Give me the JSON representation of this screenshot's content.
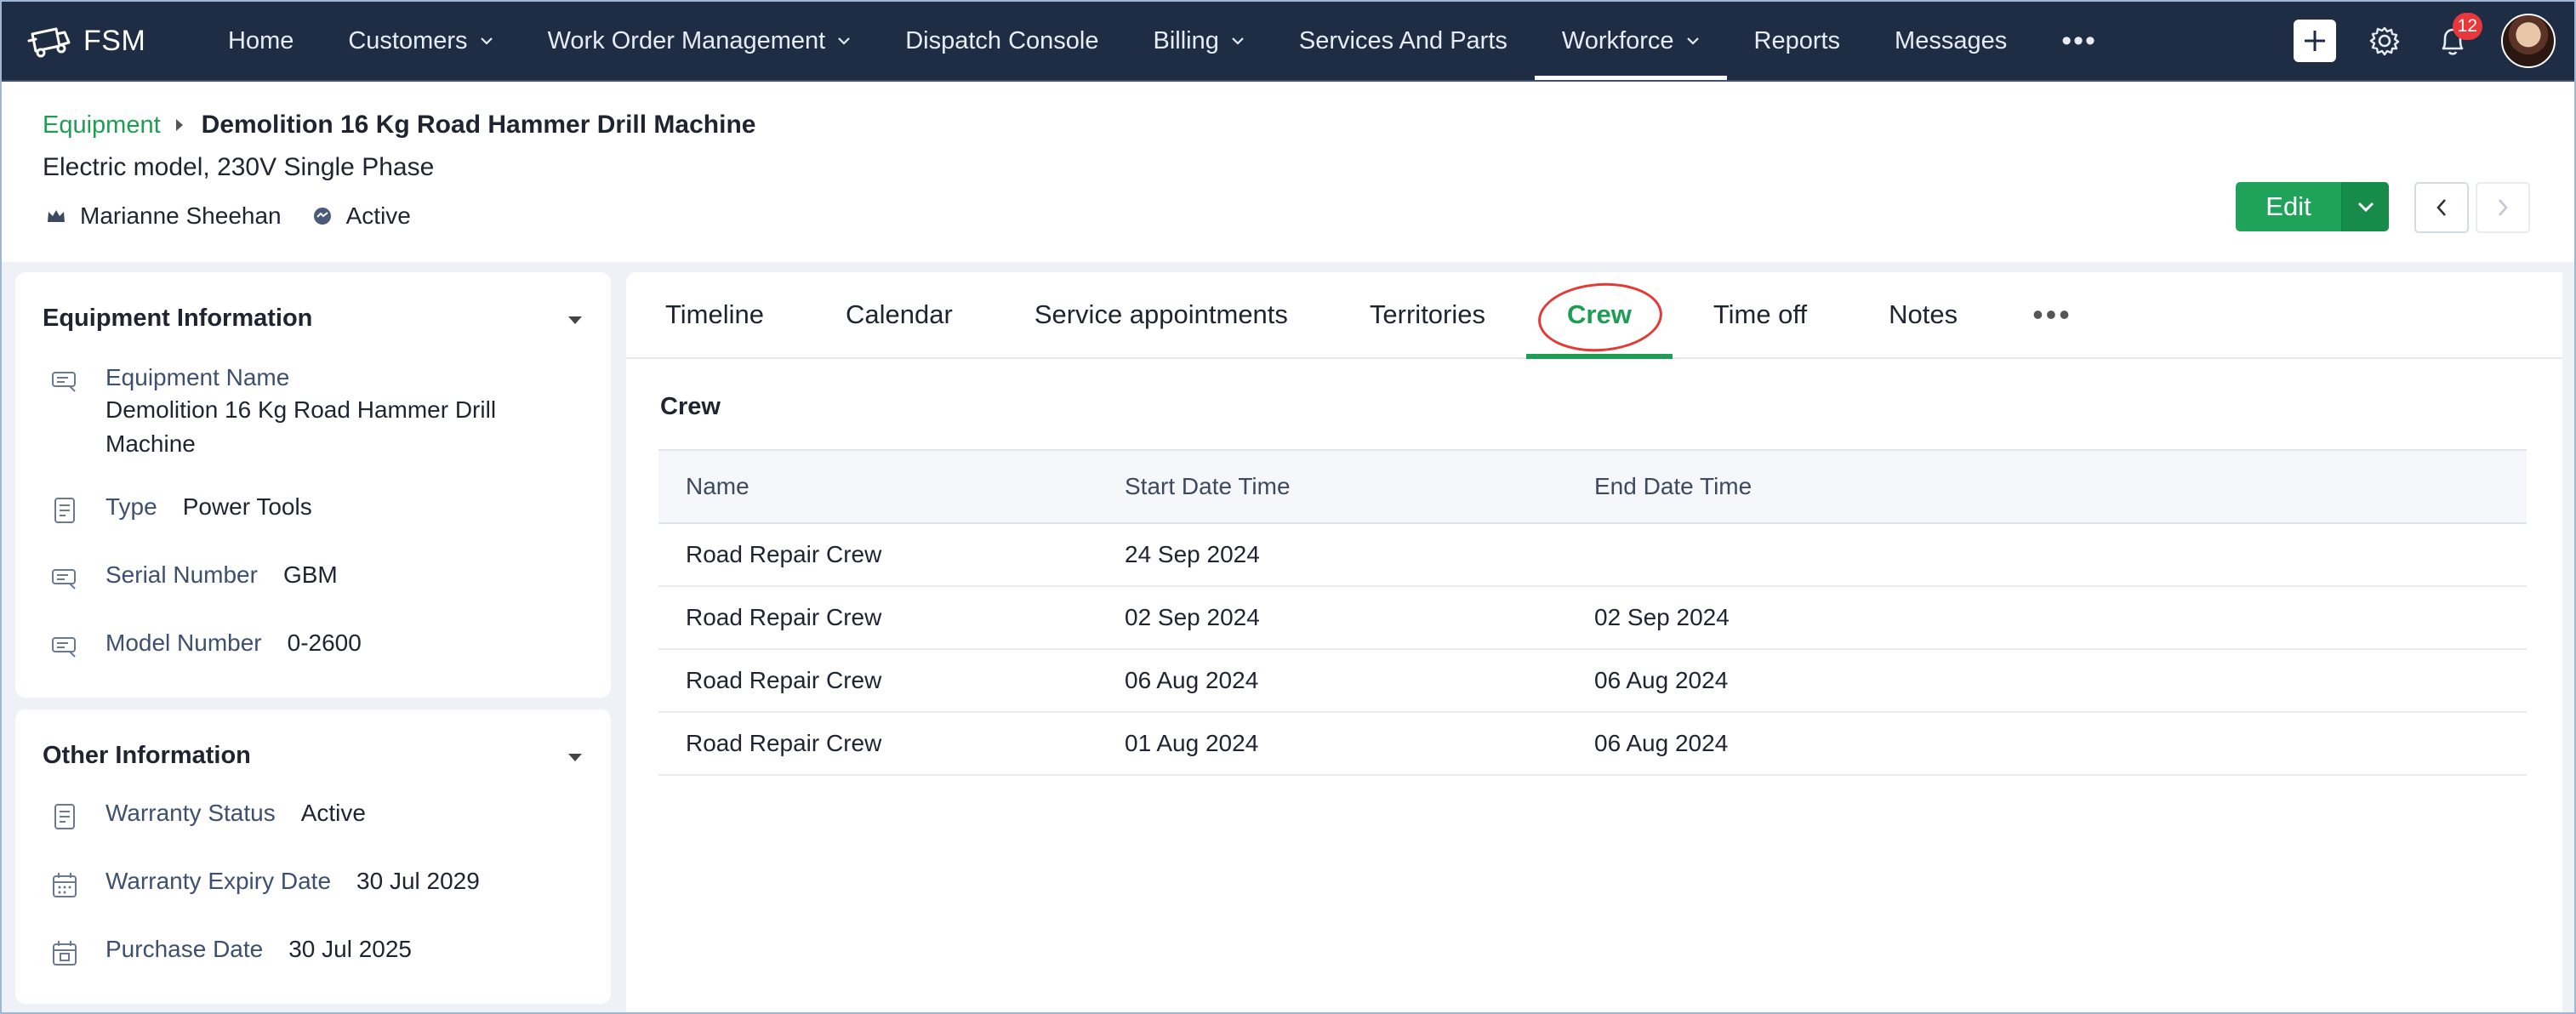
{
  "nav": {
    "brand": "FSM",
    "items": [
      {
        "label": "Home",
        "dropdown": false
      },
      {
        "label": "Customers",
        "dropdown": true
      },
      {
        "label": "Work Order Management",
        "dropdown": true
      },
      {
        "label": "Dispatch Console",
        "dropdown": false
      },
      {
        "label": "Billing",
        "dropdown": true
      },
      {
        "label": "Services And Parts",
        "dropdown": false
      },
      {
        "label": "Workforce",
        "dropdown": true,
        "active": true
      },
      {
        "label": "Reports",
        "dropdown": false
      },
      {
        "label": "Messages",
        "dropdown": false
      }
    ],
    "more": "•••",
    "notification_count": "12"
  },
  "header": {
    "breadcrumb_link": "Equipment",
    "title": "Demolition 16 Kg Road Hammer Drill Machine",
    "subtitle": "Electric model, 230V Single Phase",
    "owner": "Marianne Sheehan",
    "status": "Active",
    "edit_label": "Edit"
  },
  "equipment_info": {
    "title": "Equipment Information",
    "name_label": "Equipment Name",
    "name_value": "Demolition 16 Kg Road Hammer Drill Machine",
    "type_label": "Type",
    "type_value": "Power Tools",
    "serial_label": "Serial Number",
    "serial_value": "GBM",
    "model_label": "Model Number",
    "model_value": "0-2600"
  },
  "other_info": {
    "title": "Other Information",
    "warranty_status_label": "Warranty Status",
    "warranty_status_value": "Active",
    "warranty_expiry_label": "Warranty Expiry Date",
    "warranty_expiry_value": "30 Jul 2029",
    "purchase_date_label": "Purchase Date",
    "purchase_date_value": "30 Jul 2025"
  },
  "tabs": {
    "items": [
      "Timeline",
      "Calendar",
      "Service appointments",
      "Territories",
      "Crew",
      "Time off",
      "Notes"
    ],
    "active": "Crew",
    "more": "•••"
  },
  "crew": {
    "section_title": "Crew",
    "columns": [
      "Name",
      "Start Date Time",
      "End Date Time"
    ],
    "rows": [
      {
        "name": "Road Repair Crew",
        "start": "24 Sep 2024",
        "end": ""
      },
      {
        "name": "Road Repair Crew",
        "start": "02 Sep 2024",
        "end": "02 Sep 2024"
      },
      {
        "name": "Road Repair Crew",
        "start": "06 Aug 2024",
        "end": "06 Aug 2024"
      },
      {
        "name": "Road Repair Crew",
        "start": "01 Aug 2024",
        "end": "06 Aug 2024"
      }
    ]
  },
  "colors": {
    "nav_bg": "#1f2d44",
    "accent_green": "#1f9d55",
    "edit_button": "#1fa35a",
    "badge_red": "#e8383b",
    "annotation_red": "#e53935"
  }
}
